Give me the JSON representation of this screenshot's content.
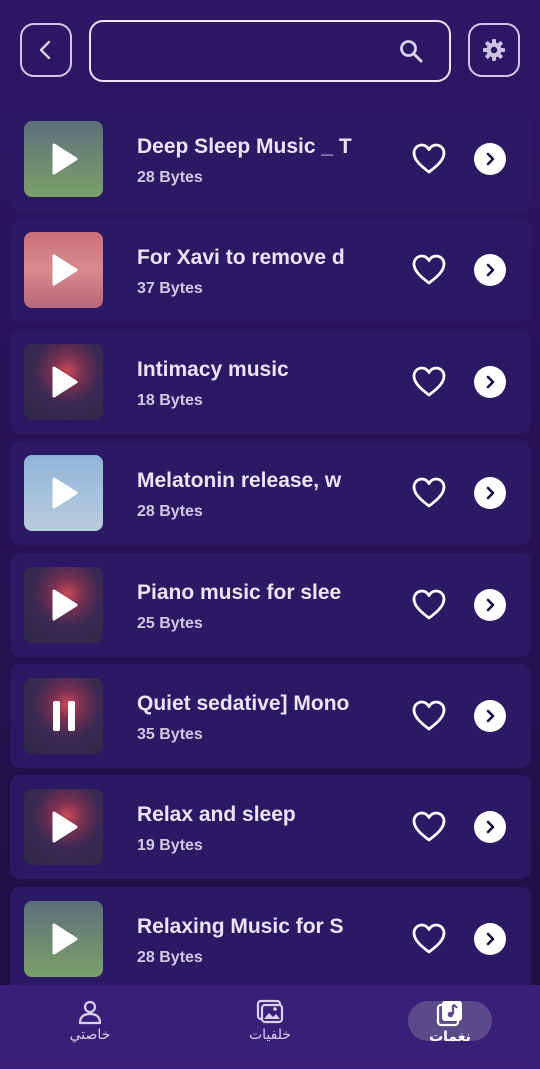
{
  "search": {
    "value": "",
    "placeholder": ""
  },
  "tracks": [
    {
      "title": "Deep Sleep Music _ T",
      "size": "28 Bytes",
      "state": "play",
      "thumb": "dandelion"
    },
    {
      "title": "For Xavi to remove d",
      "size": "37 Bytes",
      "state": "play",
      "thumb": "pink"
    },
    {
      "title": "Intimacy music",
      "size": "18 Bytes",
      "state": "play",
      "thumb": "poppy"
    },
    {
      "title": "Melatonin release, w",
      "size": "28 Bytes",
      "state": "play",
      "thumb": "blue"
    },
    {
      "title": "Piano music for slee",
      "size": "25 Bytes",
      "state": "play",
      "thumb": "poppy"
    },
    {
      "title": "Quiet sedative] Mono",
      "size": "35 Bytes",
      "state": "pause",
      "thumb": "poppy"
    },
    {
      "title": "Relax and sleep",
      "size": "19 Bytes",
      "state": "play",
      "thumb": "poppy"
    },
    {
      "title": "Relaxing Music for S",
      "size": "28 Bytes",
      "state": "play",
      "thumb": "dandelion"
    }
  ],
  "nav": {
    "items": [
      {
        "label": "خاصتي",
        "icon": "person-icon"
      },
      {
        "label": "خلفيات",
        "icon": "gallery-icon"
      },
      {
        "label": "نغمات",
        "icon": "music-note-icon",
        "active": true
      }
    ]
  },
  "colors": {
    "background": "#271457",
    "card": "#2b1963",
    "nav_bg": "#3a1f78",
    "active_pill": "#5a4a8a"
  }
}
